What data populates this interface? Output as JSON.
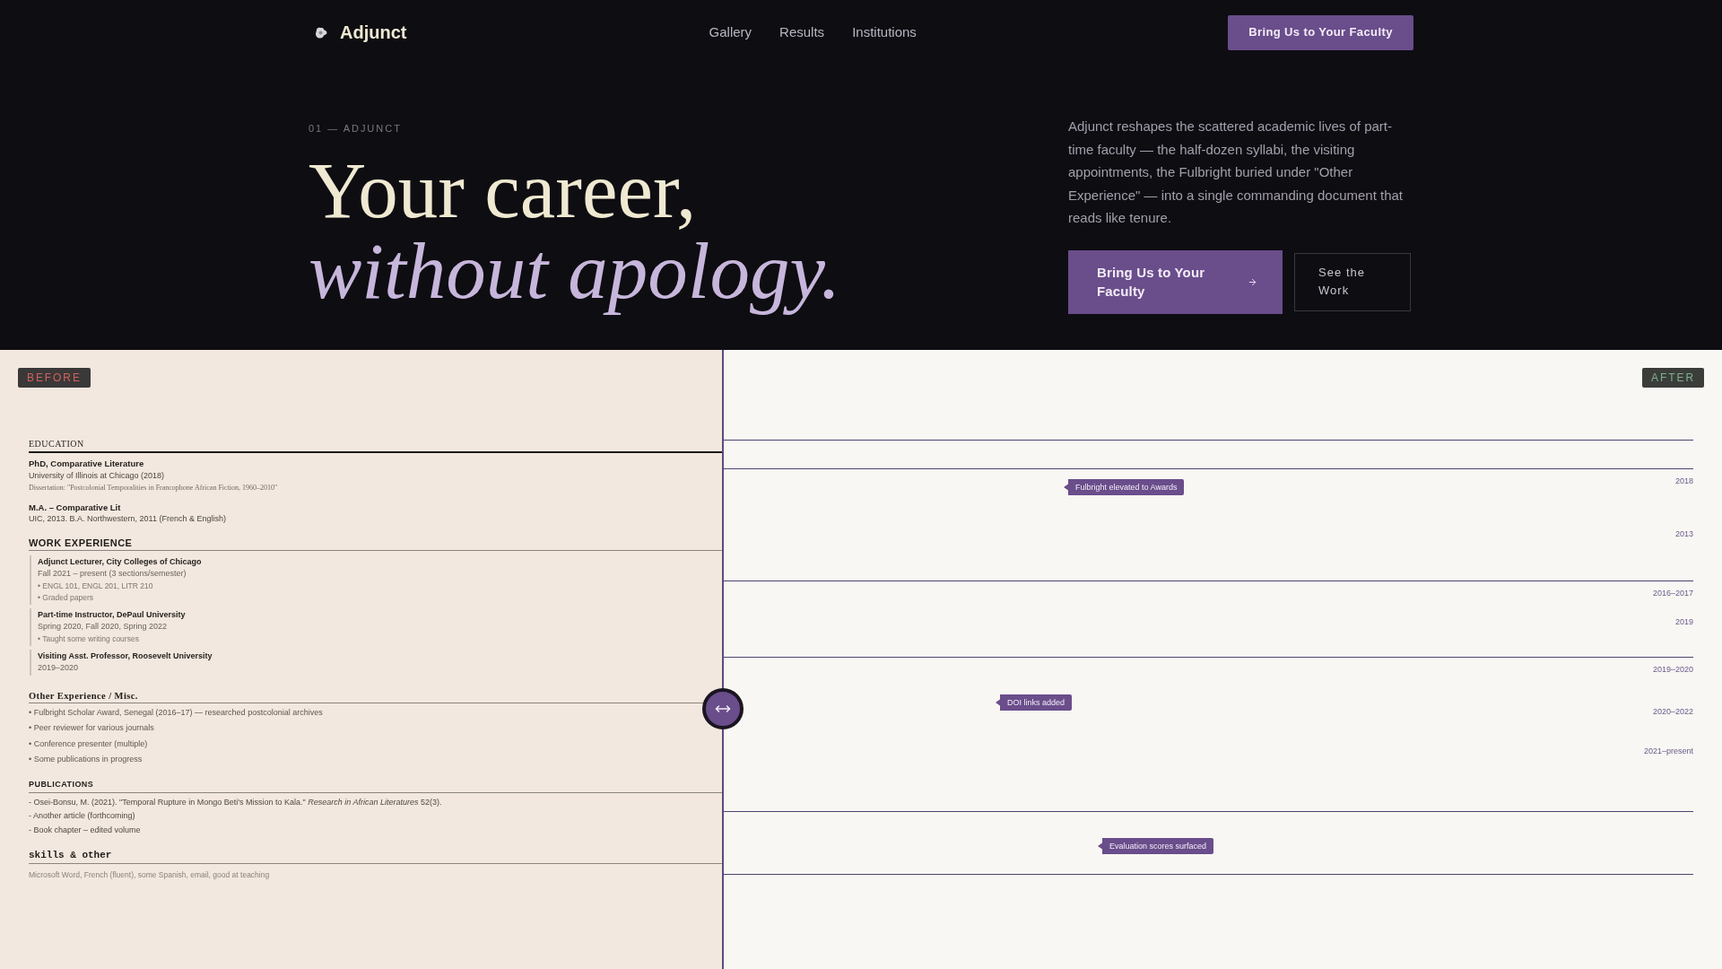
{
  "nav": {
    "brand": "Adjunct",
    "links": [
      {
        "label": "Gallery"
      },
      {
        "label": "Results"
      },
      {
        "label": "Institutions"
      }
    ],
    "cta": "Bring Us to Your Faculty"
  },
  "hero": {
    "eyebrow": "01 — ADJUNCT",
    "headline": "Your career,",
    "headline_emphasis": "without apology.",
    "description": "Adjunct reshapes the scattered academic lives of part-time faculty — the half-dozen syllabi, the visiting appointments, the Fulbright buried under \"Other Experience\" — into a single commanding document that reads like tenure.",
    "primary_button": "Bring Us to Your Faculty",
    "secondary_button": "See the Work"
  },
  "comparison": {
    "before": {
      "label": "BEFORE",
      "sections": [
        {
          "kind": "education",
          "heading": "EDUCATION",
          "entries": [
            {
              "title": "PhD, Comparative Literature",
              "lines": [
                {
                  "kind": "detail",
                  "text": "University of Illinois at Chicago (2018)"
                },
                {
                  "kind": "note",
                  "text": "Dissertation: \"Postcolonial Temporalities in Francophone African Fiction, 1960–2010\""
                }
              ]
            },
            {
              "title": "M.A. – Comparative Lit",
              "lines": [
                {
                  "kind": "detail",
                  "text": "UIC, 2013. B.A. Northwestern, 2011 (French & English)"
                }
              ]
            }
          ]
        },
        {
          "kind": "work",
          "heading": "WORK EXPERIENCE",
          "entries": [
            {
              "title": "Adjunct Lecturer, City Colleges of Chicago",
              "lines": [
                {
                  "kind": "detail",
                  "text": "Fall 2021 – present (3 sections/semester)"
                },
                {
                  "kind": "bullet",
                  "text": "• ENGL 101, ENGL 201, LITR 210"
                },
                {
                  "kind": "bullet",
                  "text": "• Graded papers"
                }
              ]
            },
            {
              "title": "Part-time Instructor, DePaul University",
              "lines": [
                {
                  "kind": "detail",
                  "text": "Spring 2020, Fall 2020, Spring 2022"
                },
                {
                  "kind": "bullet",
                  "text": "• Taught some writing courses"
                }
              ]
            },
            {
              "title": "Visiting Asst. Professor, Roosevelt University",
              "lines": [
                {
                  "kind": "detail",
                  "text": "2019–2020"
                }
              ]
            }
          ]
        },
        {
          "kind": "misc",
          "heading": "Other Experience / Misc.",
          "items": [
            "• Fulbright Scholar Award, Senegal (2016–17) — researched postcolonial archives",
            "• Peer reviewer for various journals",
            "• Conference presenter (multiple)",
            "• Some publications in progress"
          ]
        },
        {
          "kind": "publications",
          "heading": "PUBLICATIONS",
          "items": [
            "- Osei-Bonsu, M. (2021). \"Temporal Rupture in Mongo Beti's Mission to Kala.\" *Research in African Literatures* 52(3).",
            "- Another article (forthcoming)",
            "- Book chapter – edited volume"
          ]
        },
        {
          "kind": "skills",
          "heading": "skills & other",
          "items": [
            "Microsoft Word, French (fluent), some Spanish, email, good at teaching"
          ]
        }
      ]
    },
    "after": {
      "label": "AFTER",
      "blocks": [
        {
          "annotation": "Fulbright elevated to Awards",
          "dates": [
            "2018",
            "2013"
          ]
        },
        {
          "dates": [
            "2016–2017",
            "2019"
          ]
        },
        {
          "annotation": "DOI links added",
          "dates": [
            "2019–2020",
            "2020–2022",
            "2021–present"
          ]
        },
        {
          "annotation": "Evaluation scores surfaced"
        }
      ]
    }
  }
}
